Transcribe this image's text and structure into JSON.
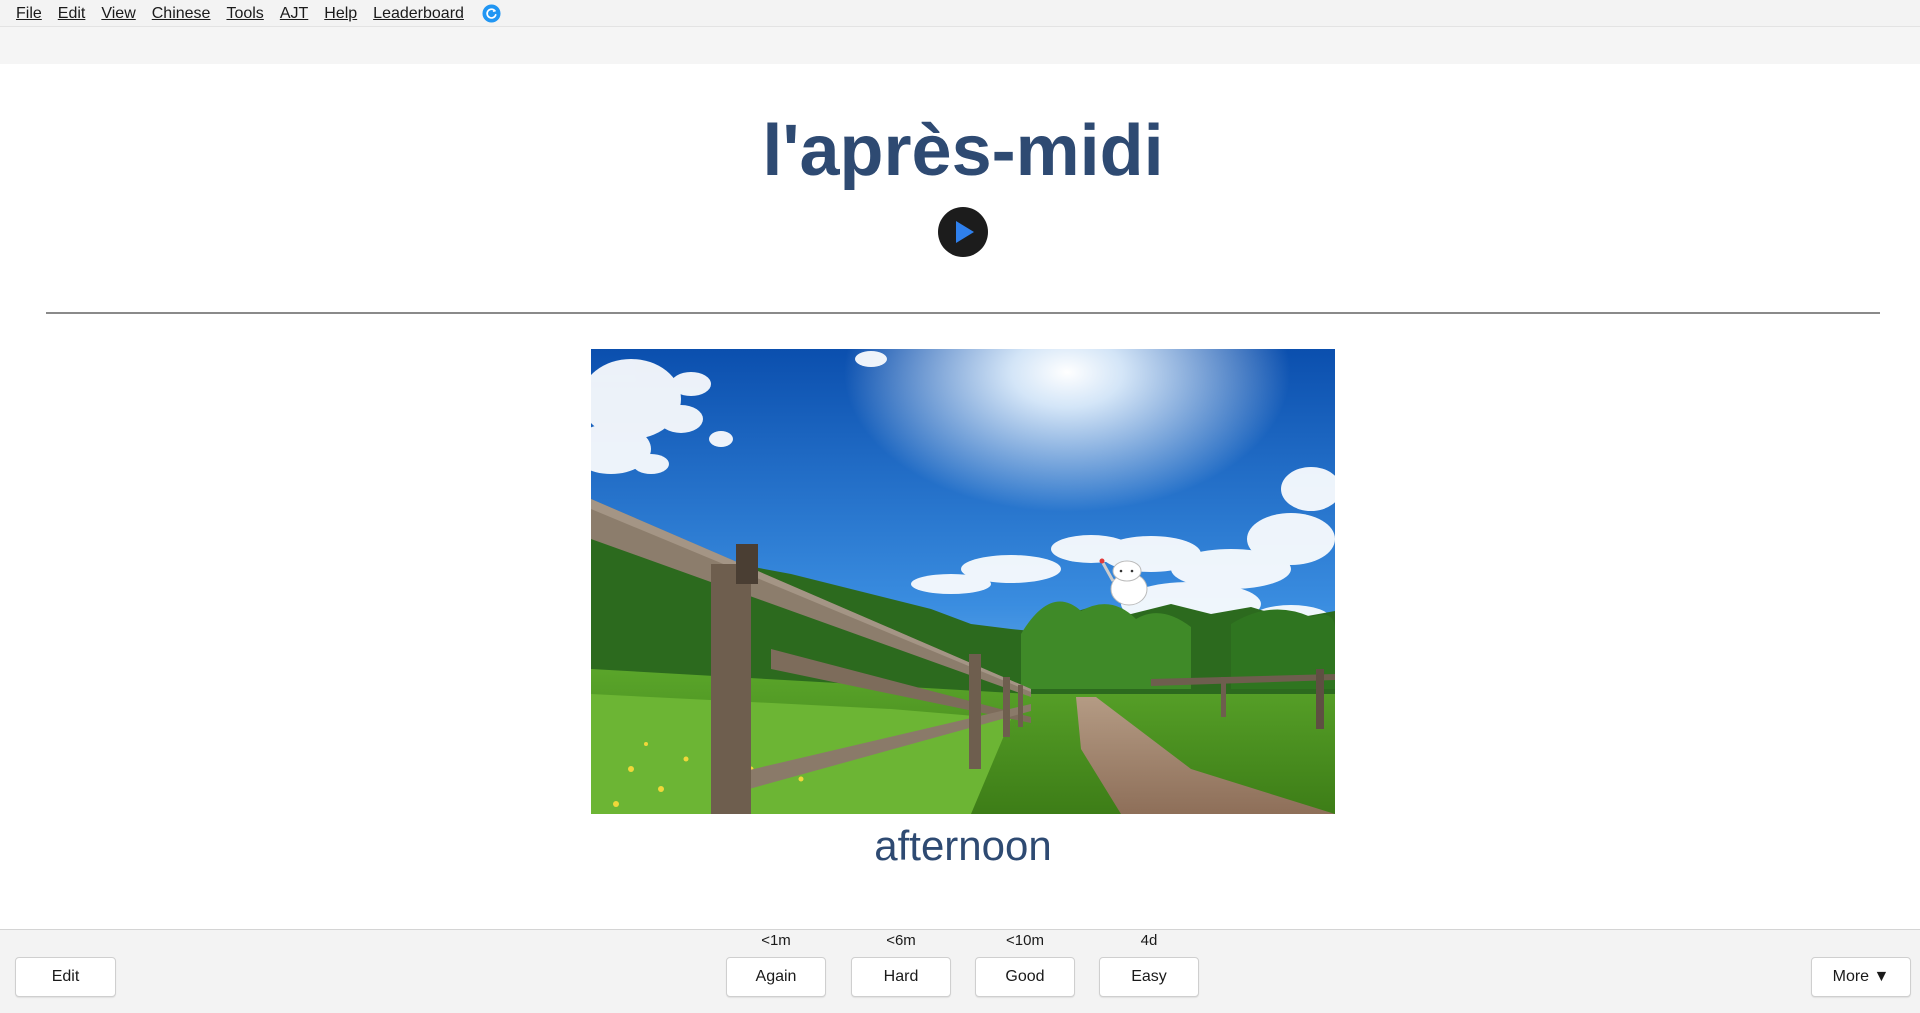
{
  "menubar": {
    "items": [
      {
        "label": "File"
      },
      {
        "label": "Edit"
      },
      {
        "label": "View"
      },
      {
        "label": "Chinese"
      },
      {
        "label": "Tools"
      },
      {
        "label": "AJT"
      },
      {
        "label": "Help"
      },
      {
        "label": "Leaderboard"
      }
    ],
    "sync_icon": "sync-icon"
  },
  "card": {
    "front_word": "l'après-midi",
    "audio_icon": "play-icon",
    "image_icon": "landscape-photo",
    "back_word": "afternoon"
  },
  "bottombar": {
    "edit_label": "Edit",
    "answers": [
      {
        "interval": "<1m",
        "label": "Again"
      },
      {
        "interval": "<6m",
        "label": "Hard"
      },
      {
        "interval": "<10m",
        "label": "Good"
      },
      {
        "interval": "4d",
        "label": "Easy"
      }
    ],
    "more_label": "More ▼"
  },
  "colors": {
    "word": "#2e4a72",
    "play_accent": "#2f80ed",
    "sync_accent": "#2196f3"
  }
}
